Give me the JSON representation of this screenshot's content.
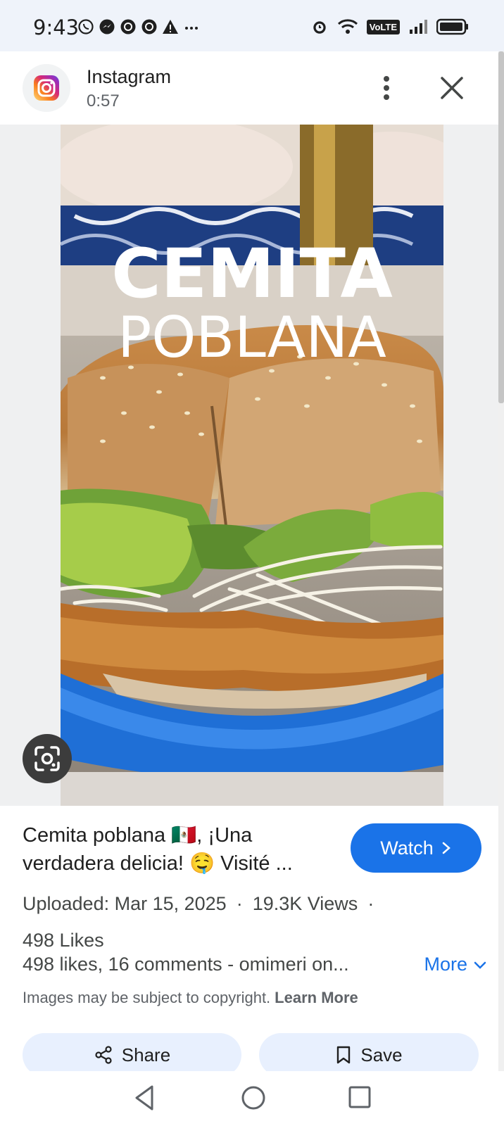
{
  "status_bar": {
    "time": "9:43",
    "left_icons": [
      "whatsapp-icon",
      "messenger-icon",
      "app-icon",
      "app-icon",
      "warning-icon",
      "more-dots"
    ],
    "right_icons": [
      "alarm-icon",
      "wifi-icon",
      "volte-badge",
      "signal-icon",
      "battery-icon"
    ],
    "volte": "VoLTE"
  },
  "header": {
    "app_name": "Instagram",
    "duration": "0:57"
  },
  "image": {
    "overlay_title_line1": "CEMITA",
    "overlay_title_line2": "POBLANA"
  },
  "info": {
    "title": "Cemita poblana 🇲🇽, ¡Una verdadera delicia! 🤤 Visité ...",
    "watch_label": "Watch",
    "uploaded": "Uploaded: Mar 15, 2025",
    "views": "19.3K Views",
    "likes": "498 Likes",
    "description": "498 likes, 16 comments - omimeri on...",
    "more_label": "More",
    "copyright": "Images may be subject to copyright.",
    "learn_more": "Learn More"
  },
  "actions": {
    "share_label": "Share",
    "save_label": "Save"
  },
  "colors": {
    "accent": "#1a73e8",
    "pill_bg": "#e8f0fe",
    "statusbar_bg": "#eff3fa"
  }
}
